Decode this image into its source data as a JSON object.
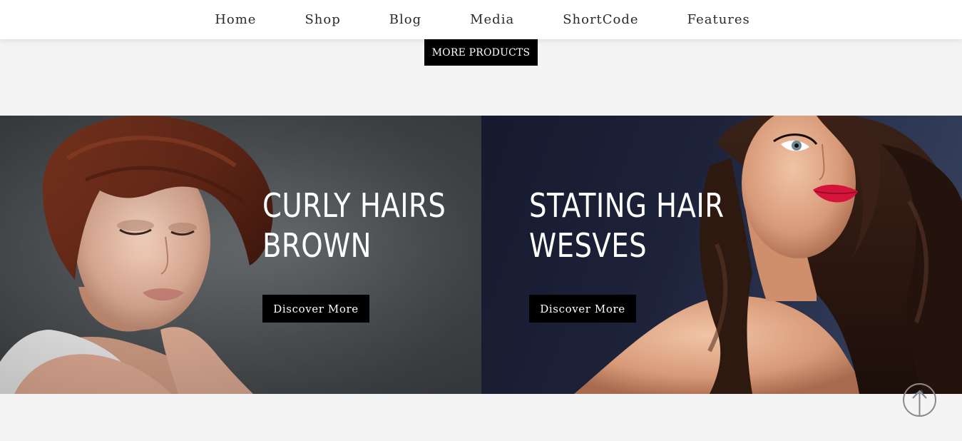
{
  "nav": {
    "items": [
      {
        "label": "Home"
      },
      {
        "label": "Shop"
      },
      {
        "label": "Blog"
      },
      {
        "label": "Media"
      },
      {
        "label": "ShortCode"
      },
      {
        "label": "Features"
      }
    ]
  },
  "products": {
    "more_label": "MORE PRODUCTS"
  },
  "banners": {
    "left": {
      "title_line1": "CURLY HAIRS",
      "title_line2": "BROWN",
      "button_label": "Discover More"
    },
    "right": {
      "title_line1": "STATING HAIR",
      "title_line2": "WESVES",
      "button_label": "Discover More"
    }
  },
  "colors": {
    "nav_bg": "#ffffff",
    "page_bg": "#f4f4f4",
    "button_bg": "#000000",
    "button_text": "#ffffff",
    "lips_accent": "#d4143a"
  },
  "icons": {
    "scroll_top": "arrow-up-circle-icon"
  }
}
